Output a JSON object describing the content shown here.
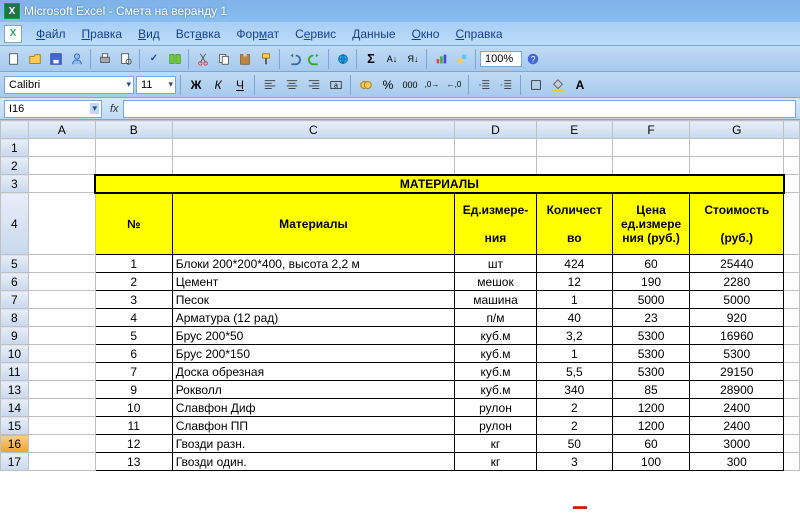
{
  "app": {
    "title": "Microsoft Excel - Смета на веранду 1"
  },
  "menu": {
    "file": "Файл",
    "edit": "Правка",
    "view": "Вид",
    "insert": "Вставка",
    "format": "Формат",
    "tools": "Сервис",
    "data": "Данные",
    "window": "Окно",
    "help": "Справка"
  },
  "toolbar": {
    "zoom": "100%"
  },
  "format": {
    "font": "Calibri",
    "size": "11"
  },
  "fxbar": {
    "namebox": "I16",
    "fx": "fx"
  },
  "columns": {
    "A": "A",
    "B": "B",
    "C": "C",
    "D": "D",
    "E": "E",
    "F": "F",
    "G": "G"
  },
  "rows_visible": [
    "1",
    "2",
    "3",
    "4",
    "5",
    "6",
    "7",
    "8",
    "9",
    "10",
    "11",
    "13",
    "14",
    "15",
    "16",
    "17"
  ],
  "sheet": {
    "title": "МАТЕРИАЛЫ",
    "headers": {
      "num": "№",
      "mat": "Материалы",
      "unit1": "Ед.измере-",
      "unit2": "ния",
      "qty1": "Количест",
      "qty2": "во",
      "price1": "Цена",
      "price2": "ед.измере",
      "price3": "ния (руб.)",
      "cost1": "Стоимость",
      "cost2": "(руб.)"
    },
    "rows": [
      {
        "n": "1",
        "name": "Блоки 200*200*400, высота 2,2 м",
        "unit": "шт",
        "qty": "424",
        "price": "60",
        "cost": "25440"
      },
      {
        "n": "2",
        "name": "Цемент",
        "unit": "мешок",
        "qty": "12",
        "price": "190",
        "cost": "2280"
      },
      {
        "n": "3",
        "name": "Песок",
        "unit": "машина",
        "qty": "1",
        "price": "5000",
        "cost": "5000"
      },
      {
        "n": "4",
        "name": "Арматура (12 рад)",
        "unit": "п/м",
        "qty": "40",
        "price": "23",
        "cost": "920"
      },
      {
        "n": "5",
        "name": "Брус 200*50",
        "unit": "куб.м",
        "qty": "3,2",
        "price": "5300",
        "cost": "16960"
      },
      {
        "n": "6",
        "name": "Брус 200*150",
        "unit": "куб.м",
        "qty": "1",
        "price": "5300",
        "cost": "5300"
      },
      {
        "n": "7",
        "name": "Доска обрезная",
        "unit": "куб.м",
        "qty": "5,5",
        "price": "5300",
        "cost": "29150"
      },
      {
        "n": "9",
        "name": "Рокволл",
        "unit": "куб.м",
        "qty": "340",
        "price": "85",
        "cost": "28900"
      },
      {
        "n": "10",
        "name": "Славфон Диф",
        "unit": "рулон",
        "qty": "2",
        "price": "1200",
        "cost": "2400"
      },
      {
        "n": "11",
        "name": "Славфон ПП",
        "unit": "рулон",
        "qty": "2",
        "price": "1200",
        "cost": "2400"
      },
      {
        "n": "12",
        "name": "Гвозди разн.",
        "unit": "кг",
        "qty": "50",
        "price": "60",
        "cost": "3000"
      },
      {
        "n": "13",
        "name": "Гвозди один.",
        "unit": "кг",
        "qty": "3",
        "price": "100",
        "cost": "300"
      }
    ]
  }
}
